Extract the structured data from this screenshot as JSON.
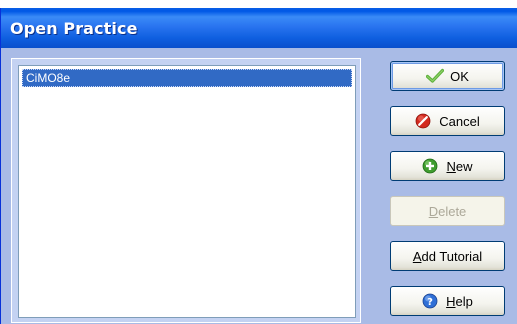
{
  "window": {
    "title": "Open Practice"
  },
  "list": {
    "items": [
      "CiMO8e"
    ],
    "selected_index": 0
  },
  "buttons": {
    "ok": {
      "label": "OK",
      "icon": "check-icon",
      "enabled": true,
      "default": true
    },
    "cancel": {
      "label": "Cancel",
      "icon": "cancel-icon",
      "enabled": true
    },
    "new": {
      "mnemonic": "N",
      "rest": "ew",
      "icon": "plus-icon",
      "enabled": true
    },
    "delete": {
      "mnemonic": "D",
      "rest": "elete",
      "enabled": false
    },
    "tutorial": {
      "mnemonic": "A",
      "rest": "dd Tutorial",
      "enabled": true
    },
    "help": {
      "mnemonic": "H",
      "rest": "elp",
      "icon": "help-icon",
      "enabled": true
    }
  },
  "colors": {
    "title_bar": "#0058e6",
    "dialog_bg": "#a9bbe6",
    "selection": "#316ac5",
    "check_green": "#5fb23d",
    "cancel_red": "#d32a1f",
    "help_blue": "#2f6fd6"
  }
}
